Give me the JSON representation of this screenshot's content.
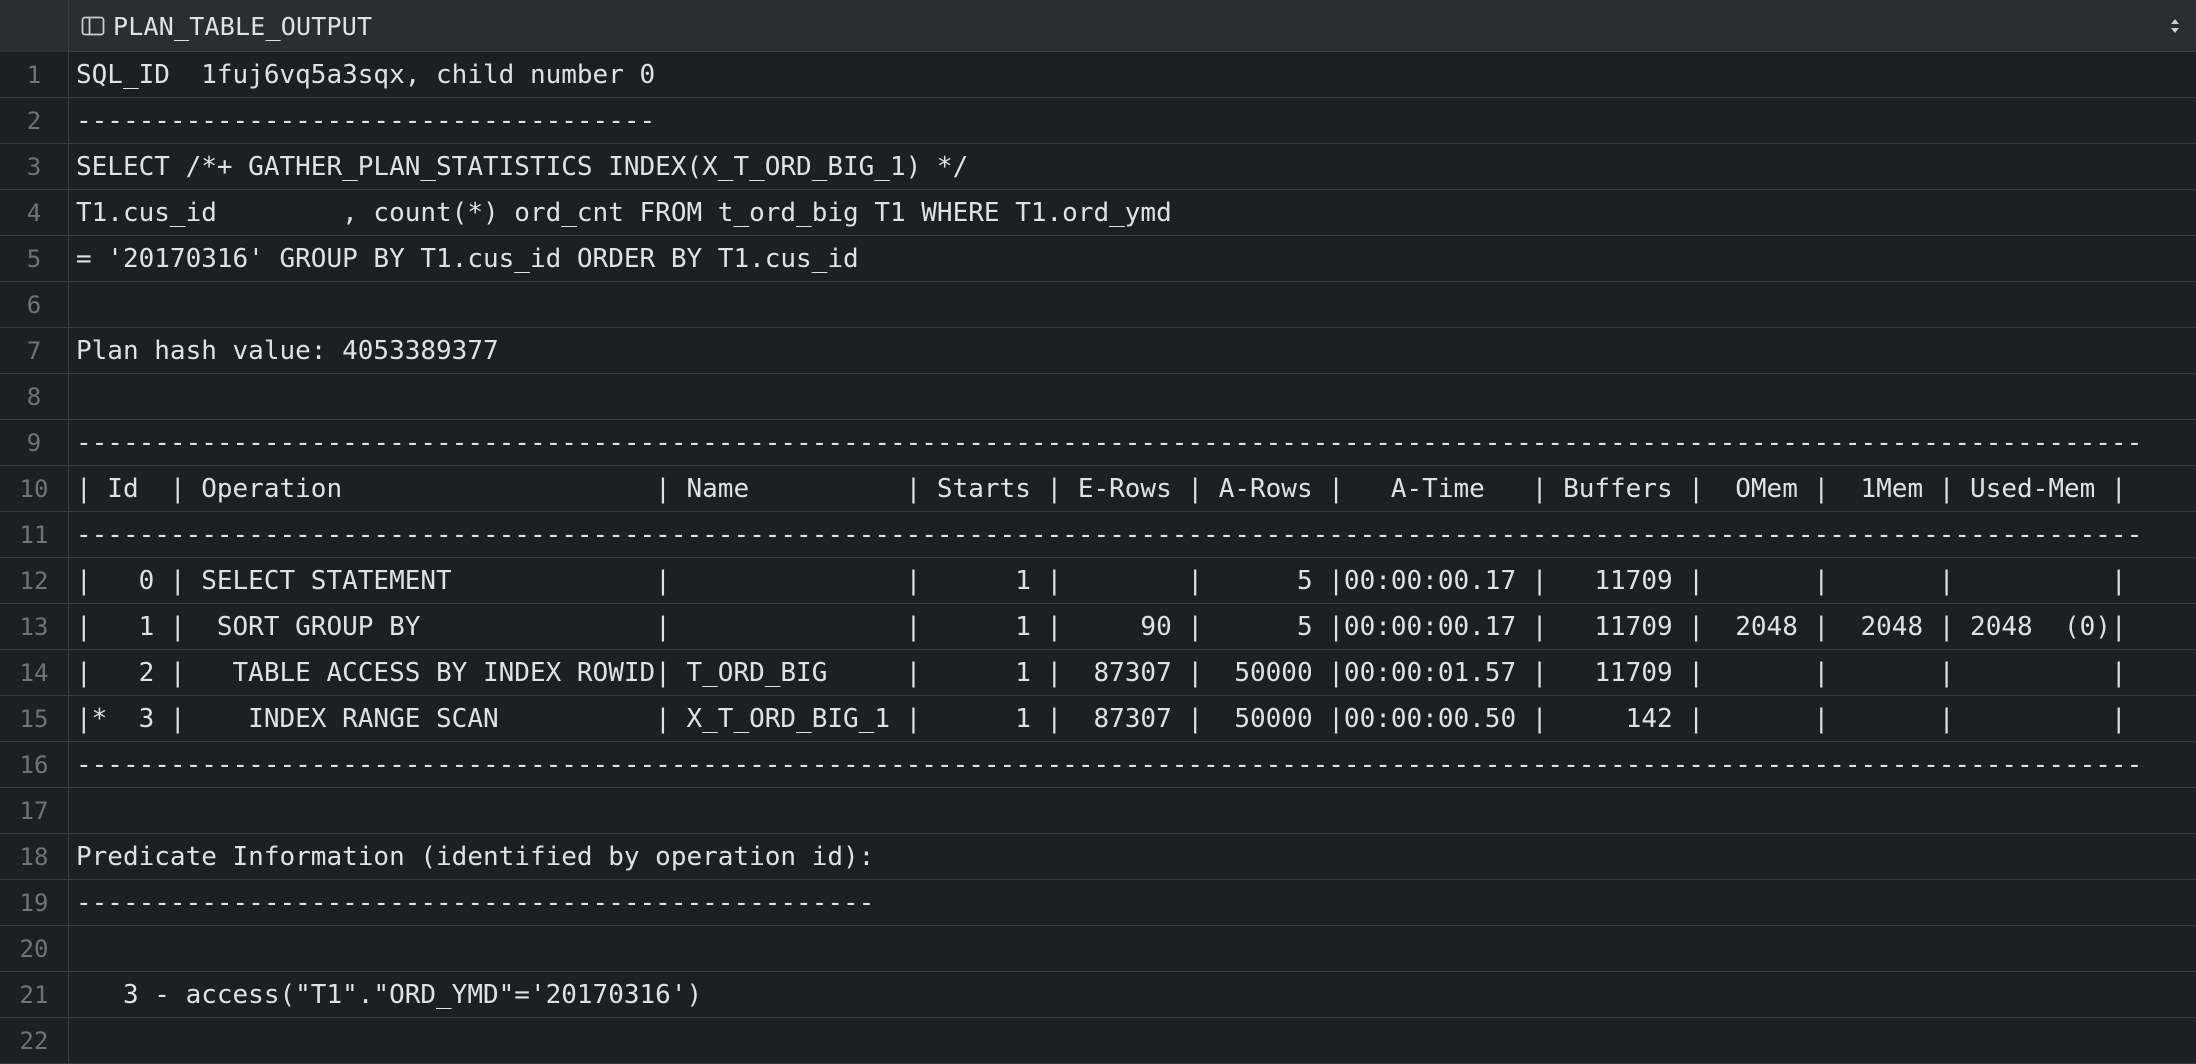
{
  "grid": {
    "column_header": "PLAN_TABLE_OUTPUT",
    "column_icon": "table-column-icon",
    "sort_icon": "sort-updown-icon",
    "rows": [
      {
        "n": "1",
        "text": "SQL_ID  1fuj6vq5a3sqx, child number 0"
      },
      {
        "n": "2",
        "text": "-------------------------------------"
      },
      {
        "n": "3",
        "text": "SELECT /*+ GATHER_PLAN_STATISTICS INDEX(X_T_ORD_BIG_1) */"
      },
      {
        "n": "4",
        "text": "T1.cus_id        , count(*) ord_cnt FROM t_ord_big T1 WHERE T1.ord_ymd"
      },
      {
        "n": "5",
        "text": "= '20170316' GROUP BY T1.cus_id ORDER BY T1.cus_id"
      },
      {
        "n": "6",
        "text": ""
      },
      {
        "n": "7",
        "text": "Plan hash value: 4053389377"
      },
      {
        "n": "8",
        "text": ""
      },
      {
        "n": "9",
        "text": "------------------------------------------------------------------------------------------------------------------------------------"
      },
      {
        "n": "10",
        "text": "| Id  | Operation                    | Name          | Starts | E-Rows | A-Rows |   A-Time   | Buffers |  OMem |  1Mem | Used-Mem |"
      },
      {
        "n": "11",
        "text": "------------------------------------------------------------------------------------------------------------------------------------"
      },
      {
        "n": "12",
        "text": "|   0 | SELECT STATEMENT             |               |      1 |        |      5 |00:00:00.17 |   11709 |       |       |          |"
      },
      {
        "n": "13",
        "text": "|   1 |  SORT GROUP BY               |               |      1 |     90 |      5 |00:00:00.17 |   11709 |  2048 |  2048 | 2048  (0)|"
      },
      {
        "n": "14",
        "text": "|   2 |   TABLE ACCESS BY INDEX ROWID| T_ORD_BIG     |      1 |  87307 |  50000 |00:00:01.57 |   11709 |       |       |          |"
      },
      {
        "n": "15",
        "text": "|*  3 |    INDEX RANGE SCAN          | X_T_ORD_BIG_1 |      1 |  87307 |  50000 |00:00:00.50 |     142 |       |       |          |"
      },
      {
        "n": "16",
        "text": "------------------------------------------------------------------------------------------------------------------------------------"
      },
      {
        "n": "17",
        "text": ""
      },
      {
        "n": "18",
        "text": "Predicate Information (identified by operation id):"
      },
      {
        "n": "19",
        "text": "---------------------------------------------------"
      },
      {
        "n": "20",
        "text": ""
      },
      {
        "n": "21",
        "text": "   3 - access(\"T1\".\"ORD_YMD\"='20170316')"
      },
      {
        "n": "22",
        "text": ""
      }
    ]
  },
  "colors": {
    "background": "#1e1f22",
    "header_background": "#2b2d30",
    "border": "#393b40",
    "text": "#dfe1e5",
    "line_number": "#6f737a"
  }
}
